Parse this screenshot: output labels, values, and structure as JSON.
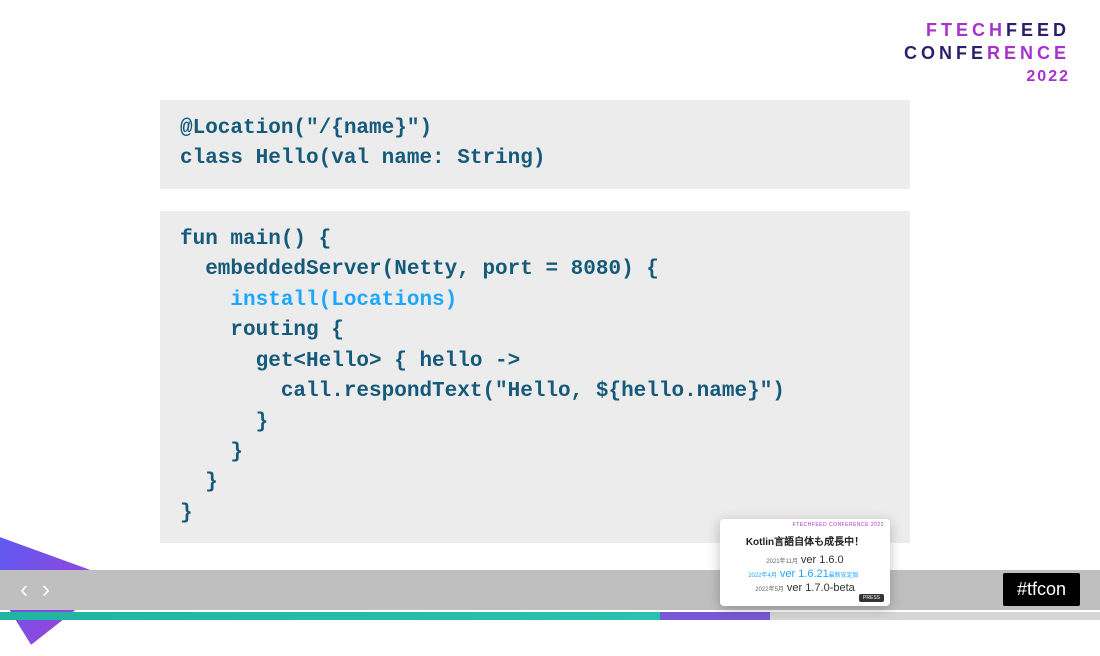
{
  "branding": {
    "line1_a": "FTECH",
    "line1_b": "FEED",
    "line2_a": "CONFE",
    "line2_b": "RENCE",
    "year": "2022"
  },
  "code": {
    "block1_line1": "@Location(\"/{name}\")",
    "block1_line2": "class Hello(val name: String)",
    "block2_line1": "fun main() {",
    "block2_line2": "  embeddedServer(Netty, port = 8080) {",
    "block2_line3": "    install(Locations)",
    "block2_line4": "    routing {",
    "block2_line5": "      get<Hello> { hello ->",
    "block2_line6": "        call.respondText(\"Hello, ${hello.name}\")",
    "block2_line7": "      }",
    "block2_line8": "    }",
    "block2_line9": "  }",
    "block2_line10": "}"
  },
  "preview": {
    "brand": "FTECHFEED\nCONFERENCE\n2022",
    "title": "Kotlin言語自体も成長中！",
    "row1_date": "2021年11月",
    "row1_ver": "ver 1.6.0",
    "row2_date": "2022年4月",
    "row2_ver": "ver 1.6.21",
    "row2_note": "最新安定版",
    "row3_date": "2022年5月",
    "row3_ver": "ver 1.7.0-beta",
    "badge": "PRESS"
  },
  "hashtag": "#tfcon",
  "nav": {
    "prev": "‹",
    "next": "›"
  },
  "progress": {
    "fill_percent": 60,
    "buffer_percent": 10
  }
}
